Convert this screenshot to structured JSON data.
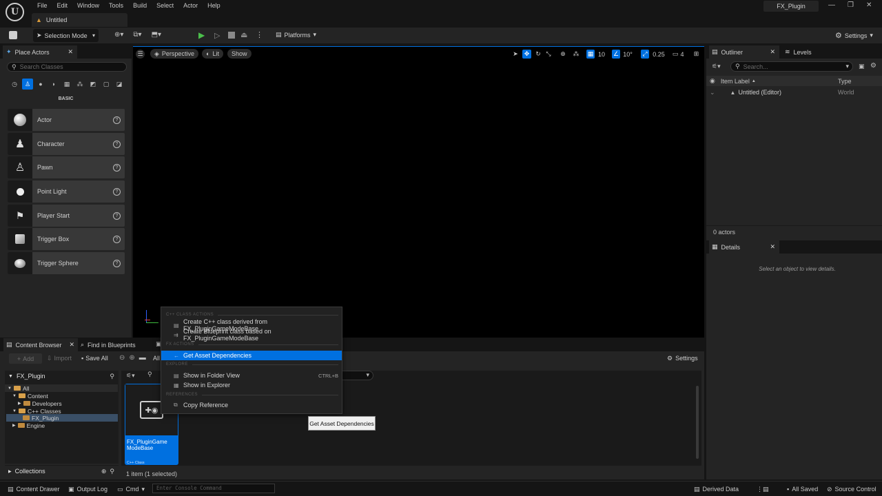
{
  "menu": [
    "File",
    "Edit",
    "Window",
    "Tools",
    "Build",
    "Select",
    "Actor",
    "Help"
  ],
  "doc_tab": "Untitled",
  "project_name": "FX_Plugin",
  "toolbar": {
    "selection_mode": "Selection Mode",
    "platforms": "Platforms",
    "settings": "Settings"
  },
  "place_actors": {
    "tab": "Place Actors",
    "search_placeholder": "Search Classes",
    "category": "BASIC",
    "items": [
      "Actor",
      "Character",
      "Pawn",
      "Point Light",
      "Player Start",
      "Trigger Box",
      "Trigger Sphere"
    ]
  },
  "viewport": {
    "perspective": "Perspective",
    "lit": "Lit",
    "show": "Show",
    "grid": "10",
    "angle": "10°",
    "scale": "0.25",
    "cam_speed": "4"
  },
  "outliner": {
    "tab": "Outliner",
    "levels_tab": "Levels",
    "search_placeholder": "Search...",
    "col_label": "Item Label",
    "col_type": "Type",
    "row_label": "Untitled (Editor)",
    "row_type": "World",
    "count": "0 actors"
  },
  "details": {
    "tab": "Details",
    "empty": "Select an object to view details."
  },
  "content_browser": {
    "tab": "Content Browser",
    "find_tab": "Find in Blueprints",
    "add": "Add",
    "import": "Import",
    "save_all": "Save All",
    "path": "All",
    "settings": "Settings",
    "root": "FX_Plugin",
    "tree": [
      "All",
      "Content",
      "Developers",
      "C++ Classes",
      "FX_Plugin",
      "Engine"
    ],
    "asset_name": "FX_PluginGame ModeBase",
    "asset_type": "C++ Class",
    "collections": "Collections",
    "status": "1 item (1 selected)"
  },
  "context_menu": {
    "sec1": "C++ CLASS ACTIONS",
    "item1": "Create C++ class derived from FX_PluginGameModeBase",
    "item2": "Create Blueprint class based on FX_PluginGameModeBase",
    "sec2": "FX ACTIONS",
    "item3": "Get Asset Dependencies",
    "sec3": "EXPLORE",
    "item4": "Show in Folder View",
    "item4_shortcut": "CTRL+B",
    "item5": "Show in Explorer",
    "sec4": "REFERENCES",
    "item6": "Copy Reference"
  },
  "tooltip": "Get Asset Dependencies",
  "statusbar": {
    "content_drawer": "Content Drawer",
    "output_log": "Output Log",
    "cmd": "Cmd",
    "console_placeholder": "Enter Console Command",
    "derived_data": "Derived Data",
    "all_saved": "All Saved",
    "source_control": "Source Control"
  },
  "colors": {
    "accent": "#0070e0",
    "panel": "#242424",
    "bg": "#151515",
    "viewport": "#000000"
  }
}
